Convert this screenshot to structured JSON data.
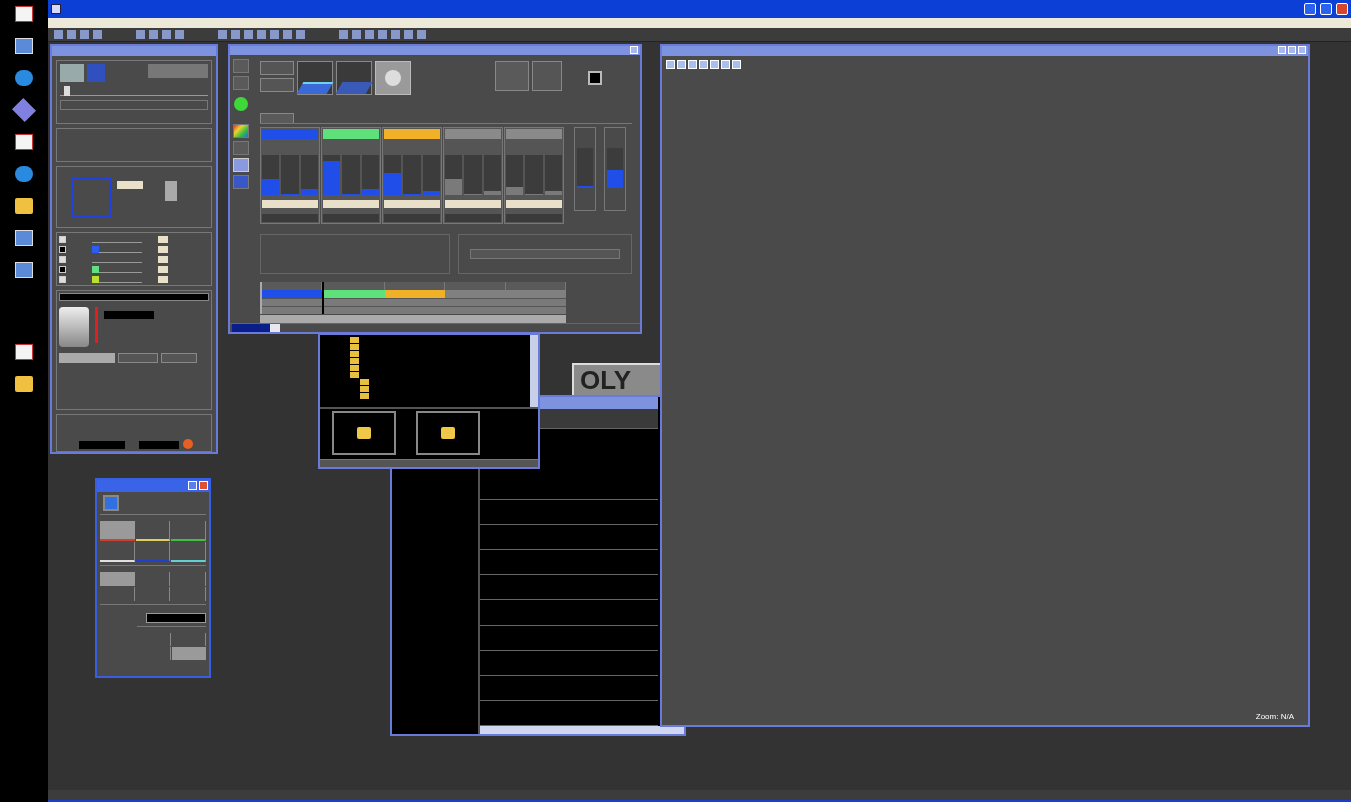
{
  "desktop_icons": [
    {
      "kind": "document"
    },
    {
      "kind": "monitor"
    },
    {
      "kind": "globe"
    },
    {
      "kind": "tools"
    },
    {
      "kind": "document"
    },
    {
      "kind": "globe"
    },
    {
      "kind": "folder"
    },
    {
      "kind": "monitor"
    },
    {
      "kind": "monitor"
    },
    {
      "kind": "document"
    },
    {
      "kind": "folder"
    }
  ],
  "laser_lines": [
    {
      "checked": true
    },
    {
      "checked": false,
      "color": "#2a5ef0"
    },
    {
      "checked": true
    },
    {
      "checked": false,
      "color": "#60e080"
    },
    {
      "checked": true,
      "color": "#b8e030"
    }
  ],
  "channels": [
    {
      "color": "#1f4fe8",
      "faders": [
        {
          "level": 0.4
        },
        {
          "level": 0.02
        },
        {
          "level": 0.15
        }
      ]
    },
    {
      "color": "#5ee07a",
      "faders": [
        {
          "level": 0.85
        },
        {
          "level": 0.02
        },
        {
          "level": 0.15
        }
      ]
    },
    {
      "color": "#f0b028",
      "faders": [
        {
          "level": 0.55
        },
        {
          "level": 0.02
        },
        {
          "level": 0.1
        }
      ]
    },
    {
      "faders": [
        {
          "level": 0.4
        },
        {
          "level": 0.02
        },
        {
          "level": 0.1
        }
      ]
    },
    {
      "faders": [
        {
          "level": 0.2
        },
        {
          "level": 0.02
        },
        {
          "level": 0.1
        }
      ]
    }
  ],
  "side_faders": [
    {
      "level": 0.06
    },
    {
      "level": 0.45
    }
  ],
  "groups": [
    {
      "color": "#1f4fe8",
      "selected": true
    },
    {
      "color": "#5ee07a",
      "selected": false
    },
    {
      "color": "#f0b028",
      "selected": false
    },
    {
      "selected": false
    },
    {
      "selected": false
    }
  ],
  "progress": {
    "level": 0.8
  },
  "scan_slider": {
    "level": 0.03
  },
  "light_path": [
    {
      "color": "#d04030",
      "selected": true
    },
    {
      "color": "#e0d060",
      "selected": false
    },
    {
      "color": "#40c040",
      "selected": false
    },
    {
      "color": "#e0e0e0",
      "selected": false
    },
    {
      "color": "#2040d0",
      "selected": false
    },
    {
      "color": "#60d0d0",
      "selected": false
    }
  ],
  "mode_buttons": [
    {
      "selected": true
    },
    {
      "selected": false
    },
    {
      "selected": false
    },
    {
      "selected": false
    },
    {
      "selected": false
    },
    {
      "selected": false
    }
  ],
  "objective_buttons": [
    {
      "selected": false
    },
    {
      "selected": false
    },
    {
      "selected": false
    },
    {
      "selected": true
    }
  ],
  "logo_text": "OLY",
  "zoom_label": "Zoom: N/A"
}
